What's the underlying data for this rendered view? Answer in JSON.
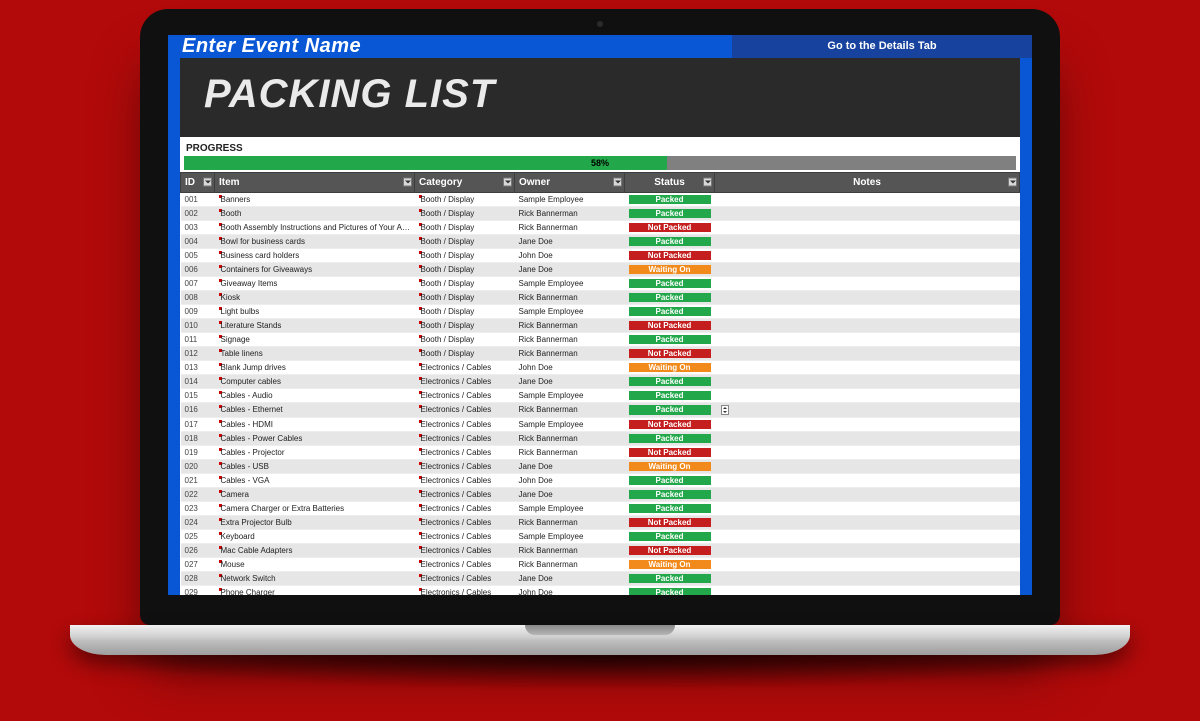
{
  "topbar": {
    "event_name": "Enter Event Name",
    "details_link": "Go to the Details Tab"
  },
  "title": "PACKING LIST",
  "progress": {
    "label": "PROGRESS",
    "percent_text": "58%",
    "percent_value": 58
  },
  "columns": {
    "id": "ID",
    "item": "Item",
    "category": "Category",
    "owner": "Owner",
    "status": "Status",
    "notes": "Notes"
  },
  "status_labels": {
    "packed": "Packed",
    "notpacked": "Not Packed",
    "waiting": "Waiting On"
  },
  "rows": [
    {
      "id": "001",
      "item": "Banners",
      "category": "Booth / Display",
      "owner": "Sample Employee",
      "status": "packed"
    },
    {
      "id": "002",
      "item": "Booth",
      "category": "Booth / Display",
      "owner": "Rick Bannerman",
      "status": "packed"
    },
    {
      "id": "003",
      "item": "Booth Assembly Instructions and Pictures of Your Assembled Booth",
      "category": "Booth / Display",
      "owner": "Rick Bannerman",
      "status": "notpacked"
    },
    {
      "id": "004",
      "item": "Bowl for business cards",
      "category": "Booth / Display",
      "owner": "Jane Doe",
      "status": "packed"
    },
    {
      "id": "005",
      "item": "Business card holders",
      "category": "Booth / Display",
      "owner": "John Doe",
      "status": "notpacked"
    },
    {
      "id": "006",
      "item": "Containers for Giveaways",
      "category": "Booth / Display",
      "owner": "Jane Doe",
      "status": "waiting"
    },
    {
      "id": "007",
      "item": "Giveaway Items",
      "category": "Booth / Display",
      "owner": "Sample Employee",
      "status": "packed"
    },
    {
      "id": "008",
      "item": "Kiosk",
      "category": "Booth / Display",
      "owner": "Rick Bannerman",
      "status": "packed"
    },
    {
      "id": "009",
      "item": "Light bulbs",
      "category": "Booth / Display",
      "owner": "Sample Employee",
      "status": "packed"
    },
    {
      "id": "010",
      "item": "Literature Stands",
      "category": "Booth / Display",
      "owner": "Rick Bannerman",
      "status": "notpacked"
    },
    {
      "id": "011",
      "item": "Signage",
      "category": "Booth / Display",
      "owner": "Rick Bannerman",
      "status": "packed"
    },
    {
      "id": "012",
      "item": "Table linens",
      "category": "Booth / Display",
      "owner": "Rick Bannerman",
      "status": "notpacked"
    },
    {
      "id": "013",
      "item": "Blank Jump drives",
      "category": "Electronics / Cables",
      "owner": "John Doe",
      "status": "waiting"
    },
    {
      "id": "014",
      "item": "Computer cables",
      "category": "Electronics / Cables",
      "owner": "Jane Doe",
      "status": "packed"
    },
    {
      "id": "015",
      "item": "Cables - Audio",
      "category": "Electronics / Cables",
      "owner": "Sample Employee",
      "status": "packed"
    },
    {
      "id": "016",
      "item": "Cables - Ethernet",
      "category": "Electronics / Cables",
      "owner": "Rick Bannerman",
      "status": "packed",
      "spinner": true
    },
    {
      "id": "017",
      "item": "Cables - HDMI",
      "category": "Electronics / Cables",
      "owner": "Sample Employee",
      "status": "notpacked"
    },
    {
      "id": "018",
      "item": "Cables - Power Cables",
      "category": "Electronics / Cables",
      "owner": "Rick Bannerman",
      "status": "packed"
    },
    {
      "id": "019",
      "item": "Cables - Projector",
      "category": "Electronics / Cables",
      "owner": "Rick Bannerman",
      "status": "notpacked"
    },
    {
      "id": "020",
      "item": "Cables - USB",
      "category": "Electronics / Cables",
      "owner": "Jane Doe",
      "status": "waiting"
    },
    {
      "id": "021",
      "item": "Cables - VGA",
      "category": "Electronics / Cables",
      "owner": "John Doe",
      "status": "packed"
    },
    {
      "id": "022",
      "item": "Camera",
      "category": "Electronics / Cables",
      "owner": "Jane Doe",
      "status": "packed"
    },
    {
      "id": "023",
      "item": "Camera Charger or Extra Batteries",
      "category": "Electronics / Cables",
      "owner": "Sample Employee",
      "status": "packed"
    },
    {
      "id": "024",
      "item": "Extra Projector Bulb",
      "category": "Electronics / Cables",
      "owner": "Rick Bannerman",
      "status": "notpacked"
    },
    {
      "id": "025",
      "item": "Keyboard",
      "category": "Electronics / Cables",
      "owner": "Sample Employee",
      "status": "packed"
    },
    {
      "id": "026",
      "item": "Mac Cable Adapters",
      "category": "Electronics / Cables",
      "owner": "Rick Bannerman",
      "status": "notpacked"
    },
    {
      "id": "027",
      "item": "Mouse",
      "category": "Electronics / Cables",
      "owner": "Rick Bannerman",
      "status": "waiting"
    },
    {
      "id": "028",
      "item": "Network Switch",
      "category": "Electronics / Cables",
      "owner": "Jane Doe",
      "status": "packed"
    },
    {
      "id": "029",
      "item": "Phone Charger",
      "category": "Electronics / Cables",
      "owner": "John Doe",
      "status": "packed"
    }
  ]
}
